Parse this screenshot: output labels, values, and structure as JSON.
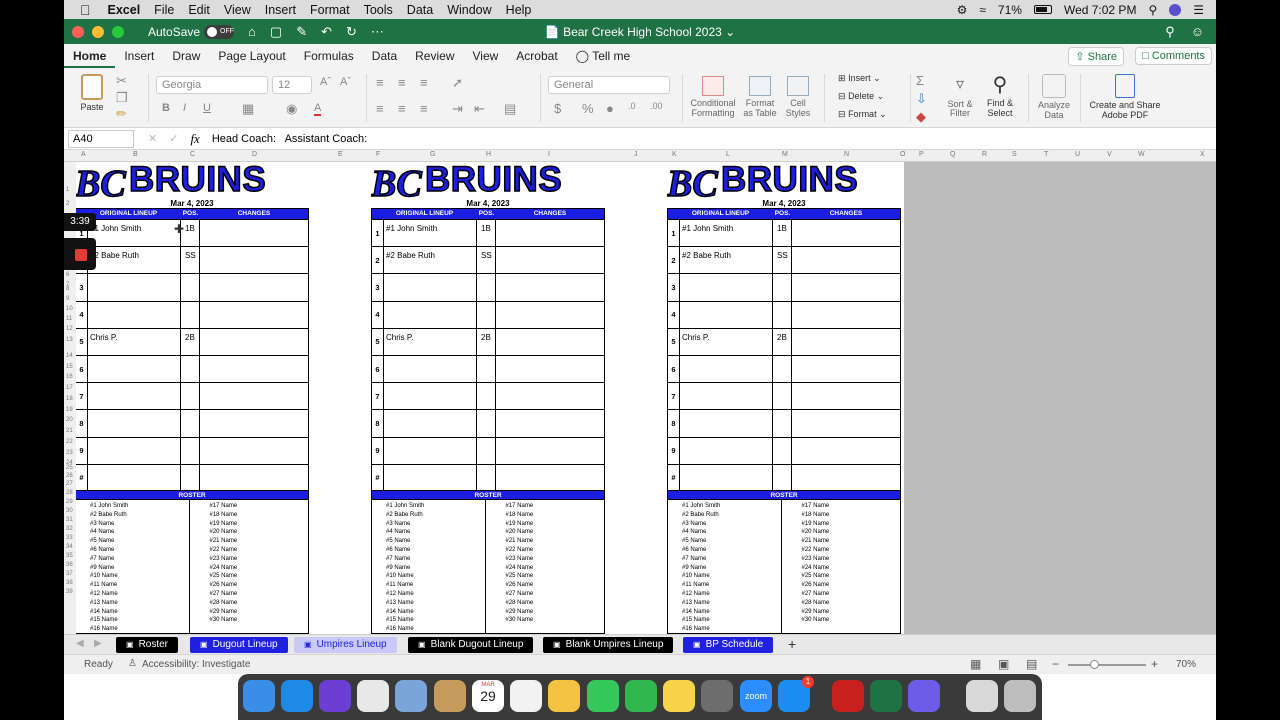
{
  "menubar": {
    "app": "Excel",
    "items": [
      "File",
      "Edit",
      "View",
      "Insert",
      "Format",
      "Tools",
      "Data",
      "Window",
      "Help"
    ],
    "battery": "71%",
    "clock": "Wed 7:02 PM"
  },
  "titlebar": {
    "autosave_label": "AutoSave",
    "autosave_state": "OFF",
    "doc_title": "Bear Creek High School 2023"
  },
  "ribbon_tabs": [
    "Home",
    "Insert",
    "Draw",
    "Page Layout",
    "Formulas",
    "Data",
    "Review",
    "View",
    "Acrobat"
  ],
  "tell_me": "Tell me",
  "share_label": "Share",
  "comments_label": "Comments",
  "ribbon": {
    "paste": "Paste",
    "font_name": "Georgia",
    "font_size": "12",
    "number_format": "General",
    "conditional": "Conditional Formatting",
    "format_table": "Format as Table",
    "cell_styles": "Cell Styles",
    "insert": "Insert",
    "delete": "Delete",
    "format": "Format",
    "sort": "Sort & Filter",
    "find": "Find & Select",
    "analyze": "Analyze Data",
    "adobe": "Create and Share Adobe PDF"
  },
  "formula": {
    "cell_ref": "A40",
    "fx": "fx",
    "content": "Head Coach:   Assistant Coach:"
  },
  "columns": [
    "A",
    "B",
    "C",
    "D",
    "E",
    "F",
    "G",
    "H",
    "I",
    "J",
    "K",
    "L",
    "M",
    "N",
    "O",
    "P",
    "Q",
    "R",
    "S",
    "T",
    "U",
    "V",
    "W",
    "X"
  ],
  "rows": [
    "1",
    "2",
    "3",
    "4",
    "5",
    "6",
    "7",
    "8",
    "9",
    "10",
    "11",
    "12",
    "13",
    "14",
    "15",
    "16",
    "17",
    "18",
    "19",
    "20",
    "21",
    "22",
    "23",
    "24",
    "25",
    "26",
    "27",
    "28",
    "29",
    "30",
    "31",
    "32",
    "33",
    "34",
    "35",
    "36",
    "37",
    "38",
    "39"
  ],
  "recording": {
    "time": "3:39"
  },
  "card": {
    "team": "BRUINS",
    "date": "Mar 4, 2023",
    "headers": {
      "lineup": "ORIGINAL LINEUP",
      "pos": "POS.",
      "changes": "CHANGES"
    },
    "roster_header": "ROSTER",
    "lineup": [
      {
        "n": "1",
        "name": "#1 John Smith",
        "pos": "1B"
      },
      {
        "n": "2",
        "name": "#2 Babe Ruth",
        "pos": "SS"
      },
      {
        "n": "3",
        "name": "",
        "pos": ""
      },
      {
        "n": "4",
        "name": "",
        "pos": ""
      },
      {
        "n": "5",
        "name": "Chris P.",
        "pos": "2B"
      },
      {
        "n": "6",
        "name": "",
        "pos": ""
      },
      {
        "n": "7",
        "name": "",
        "pos": ""
      },
      {
        "n": "8",
        "name": "",
        "pos": ""
      },
      {
        "n": "9",
        "name": "",
        "pos": ""
      },
      {
        "n": "#",
        "name": "",
        "pos": ""
      }
    ],
    "roster_left": [
      "#1 John Smith",
      "#2 Babe Ruth",
      "#3 Name",
      "#4 Name",
      "#5 Name",
      "#6 Name",
      "#7 Name",
      "#9 Name",
      "#10 Name",
      "#11 Name",
      "#12 Name",
      "#13 Name",
      "#14 Name",
      "#15 Name",
      "#16 Name"
    ],
    "roster_right": [
      "#17 Name",
      "#18 Name",
      "#19 Name",
      "#20 Name",
      "#21 Name",
      "#22 Name",
      "#23 Name",
      "#24 Name",
      "#25 Name",
      "#26 Name",
      "#27 Name",
      "#28 Name",
      "#29 Name",
      "#30 Name"
    ]
  },
  "sheet_tabs": [
    {
      "label": "Roster",
      "bg": "#000000",
      "fg": "#ffffff"
    },
    {
      "label": "Dugout Lineup",
      "bg": "#2020e0",
      "fg": "#ffffff"
    },
    {
      "label": "Umpires Lineup",
      "bg": "#c9c9f7",
      "fg": "#2020e0"
    },
    {
      "label": "Blank Dugout Lineup",
      "bg": "#000000",
      "fg": "#ffffff"
    },
    {
      "label": "Blank Umpires Lineup",
      "bg": "#000000",
      "fg": "#ffffff"
    },
    {
      "label": "BP Schedule",
      "bg": "#2020e0",
      "fg": "#ffffff"
    }
  ],
  "status": {
    "ready": "Ready",
    "accessibility": "Accessibility: Investigate",
    "zoom": "70%"
  },
  "dock": {
    "calendar_month": "MAR",
    "calendar_day": "29",
    "zoom_label": "zoom",
    "badge": "1"
  }
}
